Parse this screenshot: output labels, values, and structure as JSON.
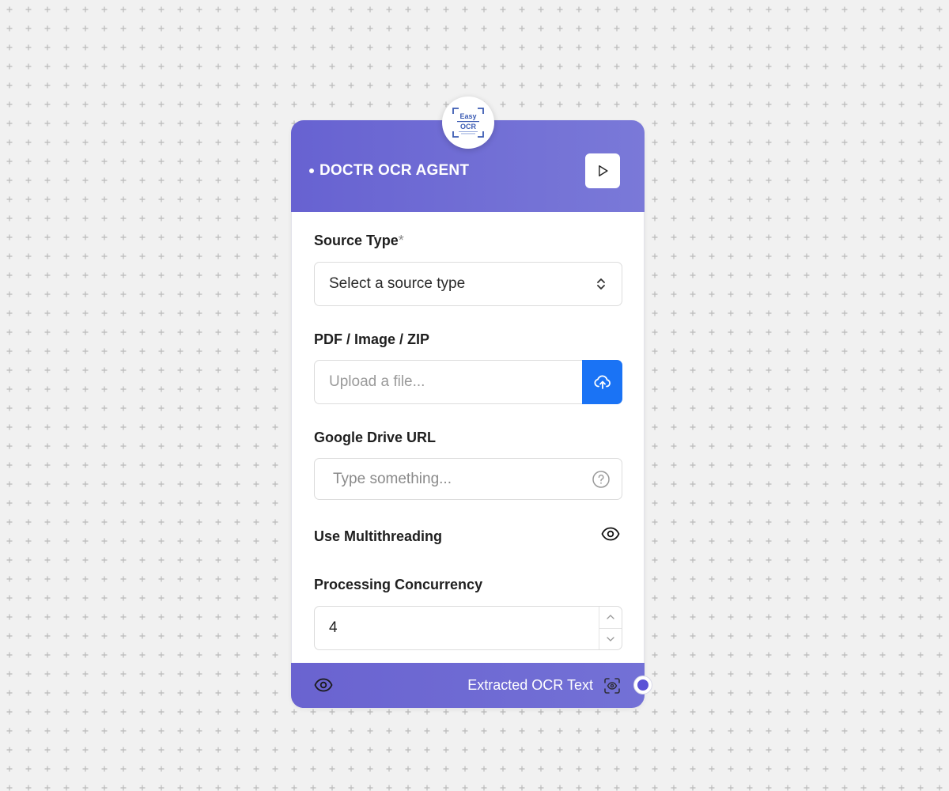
{
  "node": {
    "title": "DOCTR OCR AGENT",
    "logo": {
      "line1": "Easy",
      "line2": "OCR"
    }
  },
  "fields": {
    "source_type": {
      "label": "Source Type",
      "required_mark": "*",
      "value": "Select a source type"
    },
    "file_upload": {
      "label": "PDF / Image / ZIP",
      "placeholder": "Upload a file..."
    },
    "drive_url": {
      "label": "Google Drive URL",
      "placeholder": "Type something..."
    },
    "multithreading": {
      "label": "Use Multithreading"
    },
    "concurrency": {
      "label": "Processing Concurrency",
      "value": "4"
    }
  },
  "footer": {
    "output_label": "Extracted OCR Text"
  },
  "colors": {
    "header_gradient_start": "#6762d1",
    "header_gradient_end": "#7a79d8",
    "upload_button": "#1a73f5",
    "output_handle": "#5b53d6"
  },
  "icons": [
    "play-icon",
    "chevron-up-down-icon",
    "cloud-upload-icon",
    "help-circle-icon",
    "eye-icon",
    "chevron-up-icon",
    "chevron-down-icon",
    "scan-face-icon"
  ]
}
